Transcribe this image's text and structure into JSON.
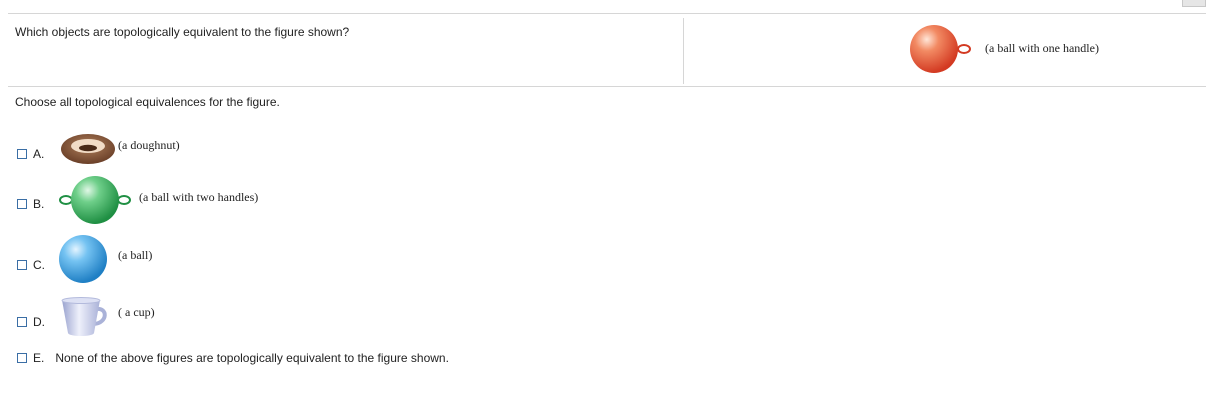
{
  "question": "Which objects are topologically equivalent to the figure shown?",
  "figure": {
    "label": "(a ball with one handle)",
    "icon": "ball-one-handle-icon"
  },
  "instruction": "Choose all topological equivalences for the figure.",
  "options": [
    {
      "letter": "A.",
      "label": "(a doughnut)",
      "icon": "doughnut-icon"
    },
    {
      "letter": "B.",
      "label": "(a ball with two handles)",
      "icon": "ball-two-handles-icon"
    },
    {
      "letter": "C.",
      "label": "(a ball)",
      "icon": "ball-icon"
    },
    {
      "letter": "D.",
      "label": "( a cup)",
      "icon": "cup-icon"
    },
    {
      "letter": "E.",
      "text": "None of the above figures are topologically equivalent to the figure shown."
    }
  ],
  "colors": {
    "checkbox_border": "#3a6ea5",
    "ball_red": "#e8553a",
    "ball_green": "#2fae55",
    "ball_blue": "#3aa2e8",
    "doughnut": "#8a5a3c",
    "cup": "#c7cde6"
  }
}
